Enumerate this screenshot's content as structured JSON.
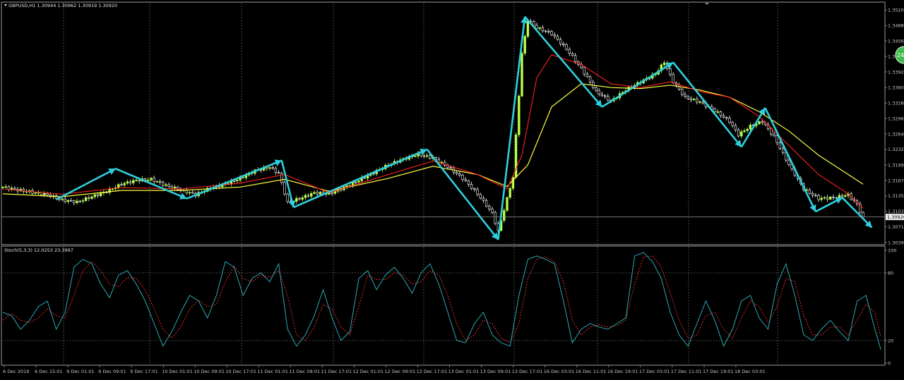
{
  "symbol_header": "GBPUSD,H1  1.30944 1.30962 1.30919 1.30920",
  "stoch_header": "Stoch(5,3,3) 12.0253 23.3997",
  "price_axis_labels": [
    "1.35205",
    "1.34885",
    "1.34565",
    "1.34245",
    "1.33925",
    "1.33600",
    "1.33280",
    "1.32960",
    "1.32640",
    "1.32320",
    "1.31995",
    "1.31675",
    "1.31355",
    "1.31035",
    "1.30715",
    "1.30390"
  ],
  "current_price_label": "1.30920",
  "stoch_axis_labels": [
    "100",
    "80",
    "20",
    "0"
  ],
  "time_labels": [
    "6 Dec 2019",
    "6 Dec 15:01",
    "9 Dec 01:01",
    "9 Dec 09:01",
    "9 Dec 17:01",
    "10 Dec 01:01",
    "10 Dec 09:01",
    "10 Dec 17:01",
    "11 Dec 01:01",
    "11 Dec 09:01",
    "11 Dec 17:01",
    "12 Dec 01:01",
    "12 Dec 09:01",
    "12 Dec 17:01",
    "13 Dec 01:01",
    "13 Dec 09:01",
    "13 Dec 17:01",
    "16 Dec 03:01",
    "16 Dec 11:01",
    "16 Dec 19:01",
    "17 Dec 03:01",
    "17 Dec 11:01",
    "17 Dec 19:01",
    "18 Dec 03:01"
  ],
  "badge_text": "24",
  "colors": {
    "background": "#000000",
    "grid": "#5a5a5a",
    "bull_candle": "#b8ff4a",
    "bear_candle": "#ffffff",
    "ma_fast": "#ff2020",
    "ma_slow": "#ffff40",
    "zigzag": "#2ecfdc",
    "stoch_main": "#2aa9b5",
    "stoch_signal": "#ff3030",
    "axis_text": "#c8c8c8",
    "badge": "#3dbb4a"
  },
  "chart_data": [
    {
      "type": "candlestick",
      "title": "GBPUSD,H1",
      "ohlc_last": {
        "open": 1.30944,
        "high": 1.30962,
        "low": 1.30919,
        "close": 1.3092
      },
      "ylim": [
        1.3039,
        1.3521
      ],
      "grid": true,
      "close_path": [
        [
          0,
          1.3154
        ],
        [
          5,
          1.3148
        ],
        [
          10,
          1.3143
        ],
        [
          15,
          1.3138
        ],
        [
          20,
          1.3127
        ],
        [
          25,
          1.3123
        ],
        [
          30,
          1.3134
        ],
        [
          35,
          1.3145
        ],
        [
          40,
          1.316
        ],
        [
          45,
          1.3168
        ],
        [
          50,
          1.317
        ],
        [
          55,
          1.3157
        ],
        [
          60,
          1.3148
        ],
        [
          65,
          1.3138
        ],
        [
          70,
          1.3152
        ],
        [
          75,
          1.316
        ],
        [
          80,
          1.3172
        ],
        [
          85,
          1.3188
        ],
        [
          90,
          1.3195
        ],
        [
          93,
          1.3182
        ],
        [
          96,
          1.3122
        ],
        [
          100,
          1.313
        ],
        [
          105,
          1.3142
        ],
        [
          110,
          1.314
        ],
        [
          115,
          1.3153
        ],
        [
          120,
          1.3168
        ],
        [
          125,
          1.3184
        ],
        [
          130,
          1.32
        ],
        [
          135,
          1.3212
        ],
        [
          140,
          1.3222
        ],
        [
          145,
          1.3214
        ],
        [
          150,
          1.3196
        ],
        [
          155,
          1.3172
        ],
        [
          160,
          1.314
        ],
        [
          165,
          1.31
        ],
        [
          167,
          1.3062
        ],
        [
          170,
          1.313
        ],
        [
          172,
          1.3175
        ],
        [
          175,
          1.343
        ],
        [
          177,
          1.35
        ],
        [
          180,
          1.3484
        ],
        [
          185,
          1.3472
        ],
        [
          190,
          1.344
        ],
        [
          195,
          1.34
        ],
        [
          200,
          1.3352
        ],
        [
          205,
          1.3332
        ],
        [
          210,
          1.3355
        ],
        [
          215,
          1.3372
        ],
        [
          220,
          1.3388
        ],
        [
          223,
          1.3413
        ],
        [
          226,
          1.3372
        ],
        [
          230,
          1.334
        ],
        [
          235,
          1.333
        ],
        [
          240,
          1.3312
        ],
        [
          245,
          1.329
        ],
        [
          248,
          1.3262
        ],
        [
          252,
          1.328
        ],
        [
          256,
          1.329
        ],
        [
          260,
          1.3258
        ],
        [
          265,
          1.32
        ],
        [
          270,
          1.315
        ],
        [
          275,
          1.313
        ],
        [
          280,
          1.3132
        ],
        [
          285,
          1.3138
        ],
        [
          288,
          1.3118
        ],
        [
          290,
          1.309
        ]
      ],
      "ma_fast": {
        "name": "",
        "points": [
          [
            0,
            1.315
          ],
          [
            20,
            1.3139
          ],
          [
            40,
            1.3153
          ],
          [
            60,
            1.315
          ],
          [
            80,
            1.3162
          ],
          [
            95,
            1.318
          ],
          [
            110,
            1.3142
          ],
          [
            130,
            1.318
          ],
          [
            145,
            1.3208
          ],
          [
            160,
            1.318
          ],
          [
            170,
            1.315
          ],
          [
            175,
            1.322
          ],
          [
            180,
            1.338
          ],
          [
            185,
            1.3428
          ],
          [
            195,
            1.3408
          ],
          [
            205,
            1.3368
          ],
          [
            215,
            1.336
          ],
          [
            225,
            1.3372
          ],
          [
            235,
            1.3352
          ],
          [
            245,
            1.334
          ],
          [
            255,
            1.33
          ],
          [
            265,
            1.324
          ],
          [
            275,
            1.318
          ],
          [
            285,
            1.314
          ],
          [
            290,
            1.311
          ]
        ]
      },
      "ma_slow": {
        "name": "",
        "points": [
          [
            0,
            1.314
          ],
          [
            20,
            1.3134
          ],
          [
            40,
            1.3147
          ],
          [
            60,
            1.3147
          ],
          [
            80,
            1.3154
          ],
          [
            95,
            1.317
          ],
          [
            110,
            1.3145
          ],
          [
            130,
            1.3172
          ],
          [
            145,
            1.3197
          ],
          [
            160,
            1.318
          ],
          [
            170,
            1.3155
          ],
          [
            177,
            1.32
          ],
          [
            185,
            1.332
          ],
          [
            195,
            1.3368
          ],
          [
            205,
            1.336
          ],
          [
            215,
            1.3358
          ],
          [
            225,
            1.3365
          ],
          [
            235,
            1.3355
          ],
          [
            245,
            1.334
          ],
          [
            255,
            1.331
          ],
          [
            265,
            1.327
          ],
          [
            275,
            1.322
          ],
          [
            285,
            1.318
          ],
          [
            290,
            1.316
          ]
        ]
      },
      "zigzag": [
        [
          18,
          1.3128
        ],
        [
          38,
          1.3192
        ],
        [
          62,
          1.313
        ],
        [
          94,
          1.3209
        ],
        [
          98,
          1.3112
        ],
        [
          143,
          1.3232
        ],
        [
          167,
          1.3045
        ],
        [
          176,
          1.3507
        ],
        [
          202,
          1.332
        ],
        [
          226,
          1.3412
        ],
        [
          249,
          1.3237
        ],
        [
          257,
          1.3318
        ],
        [
          274,
          1.3103
        ],
        [
          283,
          1.3132
        ],
        [
          293,
          1.307
        ]
      ]
    },
    {
      "type": "line",
      "title": "Stoch(5,3,3)",
      "values_last": {
        "main": 12.0253,
        "signal": 23.3997
      },
      "ylim": [
        0,
        100
      ],
      "levels": [
        20,
        80
      ],
      "main": [
        [
          0,
          45
        ],
        [
          3,
          42
        ],
        [
          6,
          30
        ],
        [
          9,
          38
        ],
        [
          12,
          50
        ],
        [
          15,
          55
        ],
        [
          18,
          30
        ],
        [
          21,
          45
        ],
        [
          24,
          85
        ],
        [
          27,
          92
        ],
        [
          30,
          88
        ],
        [
          33,
          70
        ],
        [
          36,
          58
        ],
        [
          39,
          78
        ],
        [
          42,
          82
        ],
        [
          45,
          70
        ],
        [
          48,
          55
        ],
        [
          51,
          35
        ],
        [
          54,
          15
        ],
        [
          57,
          28
        ],
        [
          60,
          45
        ],
        [
          63,
          60
        ],
        [
          66,
          55
        ],
        [
          69,
          40
        ],
        [
          72,
          60
        ],
        [
          75,
          90
        ],
        [
          78,
          85
        ],
        [
          81,
          60
        ],
        [
          84,
          75
        ],
        [
          87,
          80
        ],
        [
          90,
          72
        ],
        [
          93,
          88
        ],
        [
          96,
          30
        ],
        [
          99,
          15
        ],
        [
          102,
          25
        ],
        [
          105,
          42
        ],
        [
          108,
          65
        ],
        [
          111,
          40
        ],
        [
          114,
          20
        ],
        [
          117,
          28
        ],
        [
          120,
          75
        ],
        [
          123,
          82
        ],
        [
          126,
          65
        ],
        [
          129,
          78
        ],
        [
          132,
          85
        ],
        [
          135,
          75
        ],
        [
          138,
          62
        ],
        [
          141,
          80
        ],
        [
          144,
          88
        ],
        [
          147,
          70
        ],
        [
          150,
          45
        ],
        [
          153,
          20
        ],
        [
          156,
          18
        ],
        [
          159,
          35
        ],
        [
          162,
          45
        ],
        [
          165,
          25
        ],
        [
          168,
          18
        ],
        [
          171,
          15
        ],
        [
          174,
          60
        ],
        [
          177,
          92
        ],
        [
          180,
          95
        ],
        [
          183,
          92
        ],
        [
          186,
          88
        ],
        [
          189,
          55
        ],
        [
          192,
          18
        ],
        [
          195,
          30
        ],
        [
          198,
          35
        ],
        [
          201,
          32
        ],
        [
          204,
          30
        ],
        [
          207,
          35
        ],
        [
          210,
          40
        ],
        [
          213,
          95
        ],
        [
          216,
          98
        ],
        [
          219,
          90
        ],
        [
          222,
          75
        ],
        [
          225,
          45
        ],
        [
          228,
          25
        ],
        [
          231,
          15
        ],
        [
          234,
          35
        ],
        [
          237,
          55
        ],
        [
          240,
          38
        ],
        [
          243,
          15
        ],
        [
          246,
          30
        ],
        [
          249,
          55
        ],
        [
          252,
          60
        ],
        [
          255,
          40
        ],
        [
          258,
          30
        ],
        [
          261,
          70
        ],
        [
          264,
          88
        ],
        [
          267,
          60
        ],
        [
          270,
          25
        ],
        [
          273,
          20
        ],
        [
          276,
          30
        ],
        [
          279,
          38
        ],
        [
          282,
          28
        ],
        [
          285,
          20
        ],
        [
          288,
          55
        ],
        [
          291,
          60
        ],
        [
          294,
          30
        ],
        [
          296,
          12
        ]
      ],
      "signal": [
        [
          0,
          38
        ],
        [
          3,
          44
        ],
        [
          6,
          38
        ],
        [
          9,
          36
        ],
        [
          12,
          40
        ],
        [
          15,
          48
        ],
        [
          18,
          42
        ],
        [
          21,
          40
        ],
        [
          24,
          60
        ],
        [
          27,
          82
        ],
        [
          30,
          90
        ],
        [
          33,
          82
        ],
        [
          36,
          70
        ],
        [
          39,
          68
        ],
        [
          42,
          76
        ],
        [
          45,
          75
        ],
        [
          48,
          65
        ],
        [
          51,
          48
        ],
        [
          54,
          30
        ],
        [
          57,
          22
        ],
        [
          60,
          32
        ],
        [
          63,
          48
        ],
        [
          66,
          56
        ],
        [
          69,
          50
        ],
        [
          72,
          52
        ],
        [
          75,
          72
        ],
        [
          78,
          86
        ],
        [
          81,
          75
        ],
        [
          84,
          72
        ],
        [
          87,
          78
        ],
        [
          90,
          76
        ],
        [
          93,
          82
        ],
        [
          96,
          60
        ],
        [
          99,
          25
        ],
        [
          102,
          20
        ],
        [
          105,
          32
        ],
        [
          108,
          52
        ],
        [
          111,
          48
        ],
        [
          114,
          32
        ],
        [
          117,
          25
        ],
        [
          120,
          50
        ],
        [
          123,
          78
        ],
        [
          126,
          74
        ],
        [
          129,
          74
        ],
        [
          132,
          80
        ],
        [
          135,
          78
        ],
        [
          138,
          70
        ],
        [
          141,
          72
        ],
        [
          144,
          82
        ],
        [
          147,
          78
        ],
        [
          150,
          60
        ],
        [
          153,
          35
        ],
        [
          156,
          20
        ],
        [
          159,
          25
        ],
        [
          162,
          38
        ],
        [
          165,
          35
        ],
        [
          168,
          22
        ],
        [
          171,
          18
        ],
        [
          174,
          35
        ],
        [
          177,
          75
        ],
        [
          180,
          92
        ],
        [
          183,
          94
        ],
        [
          186,
          90
        ],
        [
          189,
          72
        ],
        [
          192,
          38
        ],
        [
          195,
          25
        ],
        [
          198,
          32
        ],
        [
          201,
          34
        ],
        [
          204,
          32
        ],
        [
          207,
          33
        ],
        [
          210,
          38
        ],
        [
          213,
          70
        ],
        [
          216,
          94
        ],
        [
          219,
          95
        ],
        [
          222,
          85
        ],
        [
          225,
          62
        ],
        [
          228,
          38
        ],
        [
          231,
          22
        ],
        [
          234,
          25
        ],
        [
          237,
          42
        ],
        [
          240,
          45
        ],
        [
          243,
          30
        ],
        [
          246,
          22
        ],
        [
          249,
          40
        ],
        [
          252,
          55
        ],
        [
          255,
          50
        ],
        [
          258,
          36
        ],
        [
          261,
          50
        ],
        [
          264,
          75
        ],
        [
          267,
          72
        ],
        [
          270,
          42
        ],
        [
          273,
          25
        ],
        [
          276,
          25
        ],
        [
          279,
          32
        ],
        [
          282,
          32
        ],
        [
          285,
          25
        ],
        [
          288,
          38
        ],
        [
          291,
          52
        ],
        [
          294,
          45
        ],
        [
          296,
          23
        ]
      ]
    }
  ]
}
